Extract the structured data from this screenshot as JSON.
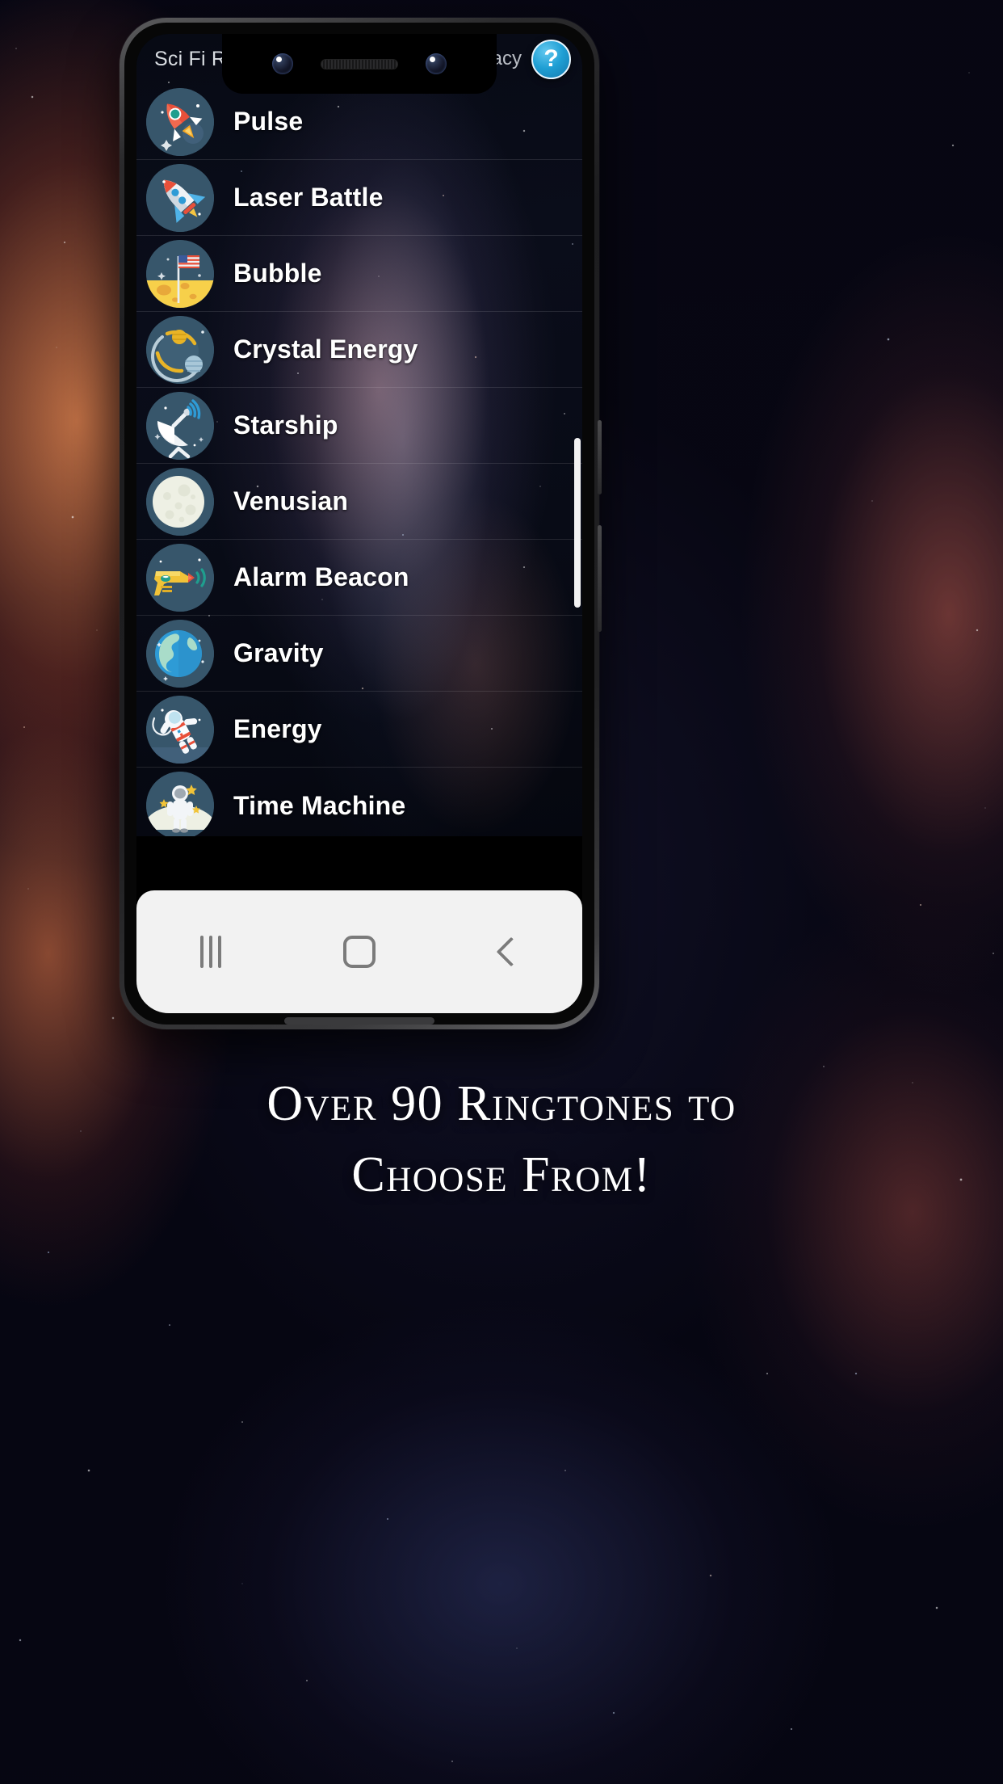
{
  "app": {
    "title": "Sci Fi Ringtones",
    "privacy_label": "Privacy",
    "help_label": "?",
    "accent_color": "#1f9fd4",
    "icon_bg_color": "#37566b",
    "text_color": "#ffffff"
  },
  "ringtones": [
    {
      "name": "Pulse",
      "icon": "rocket-launch-icon"
    },
    {
      "name": "Laser Battle",
      "icon": "rocket-blue-icon"
    },
    {
      "name": "Bubble",
      "icon": "moon-flag-icon"
    },
    {
      "name": "Crystal Energy",
      "icon": "orbit-planets-icon"
    },
    {
      "name": "Starship",
      "icon": "satellite-dish-icon"
    },
    {
      "name": "Venusian",
      "icon": "full-moon-icon"
    },
    {
      "name": "Alarm Beacon",
      "icon": "ray-gun-icon"
    },
    {
      "name": "Gravity",
      "icon": "earth-globe-icon"
    },
    {
      "name": "Energy",
      "icon": "floating-astronaut-icon"
    },
    {
      "name": "Time Machine",
      "icon": "standing-astronaut-icon"
    }
  ],
  "navbar": {
    "recents_label": "Recents",
    "home_label": "Home",
    "back_label": "Back"
  },
  "caption": {
    "line1": "Over 90 Ringtones to",
    "line2": "Choose From!"
  }
}
